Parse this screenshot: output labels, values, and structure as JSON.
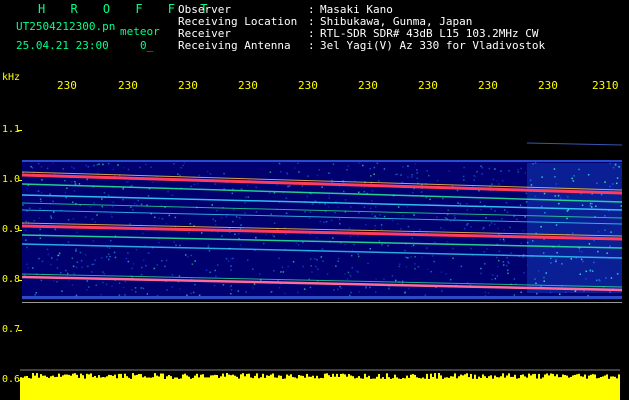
{
  "header": {
    "title": "H R O F F T",
    "file_name": "UT2504212300.pn",
    "tag": "meteor",
    "date_time": "25.04.21 23:00",
    "sequence": "0_"
  },
  "info": [
    {
      "label": "Observer",
      "value": "Masaki Kano"
    },
    {
      "label": "Receiving Location",
      "value": "Shibukawa, Gunma, Japan"
    },
    {
      "label": "Receiver",
      "value": "RTL-SDR SDR# 43dB L15 103.2MHz CW"
    },
    {
      "label": "Receiving Antenna",
      "value": "3el Yagi(V) Az 330 for Vladivostok"
    }
  ],
  "axis": {
    "y_unit": "kHz",
    "x_ticks": [
      "230",
      "230",
      "230",
      "230",
      "230",
      "230",
      "230",
      "230",
      "230",
      "2310"
    ],
    "y_ticks": [
      "1.1",
      "1.0",
      "0.9",
      "0.8",
      "0.7",
      "0.6"
    ]
  },
  "colors": {
    "header_green": "#00ff88",
    "axis_yellow": "#ffff00",
    "power_yellow": "#ffff00",
    "spectrum_bg": "#000070"
  }
}
